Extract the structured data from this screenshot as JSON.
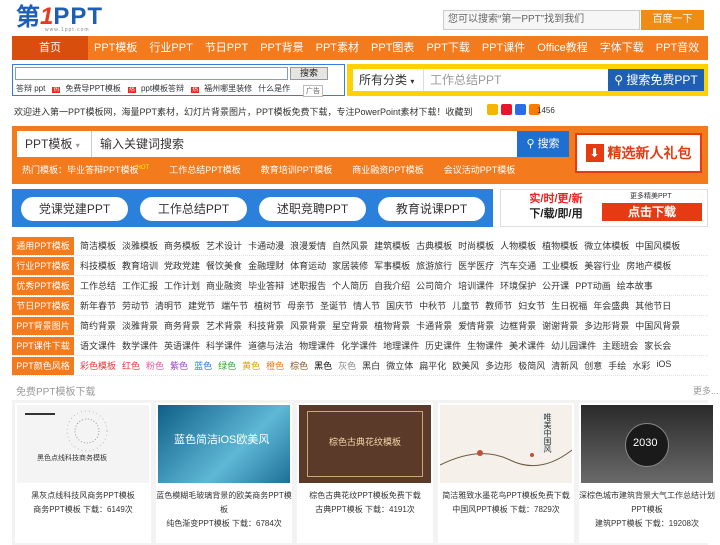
{
  "header": {
    "logo_text_1": "第",
    "logo_text_2": "1",
    "logo_text_3": "PPT",
    "logo_sub": "www.1ppt.com",
    "search_placeholder": "您可以搜索“第一PPT”找到我们",
    "search_button": "百度一下"
  },
  "nav": [
    "首页",
    "PPT模板",
    "行业PPT",
    "节日PPT",
    "PPT背景",
    "PPT素材",
    "PPT图表",
    "PPT下载",
    "PPT课件",
    "Office教程",
    "字体下载",
    "PPT音效"
  ],
  "ad_search": {
    "button": "搜索",
    "links": [
      {
        "text": "答辩 ppt",
        "hot": "热"
      },
      {
        "text": "免费导PPT模板",
        "hot": "热"
      },
      {
        "text": "ppt模板答辩",
        "hot": "热"
      },
      {
        "text": "福州哪里装修",
        "hot": ""
      },
      {
        "text": "什么是作",
        "hot": ""
      }
    ],
    "ad_tag": "广告"
  },
  "category_search": {
    "category": "所有分类",
    "placeholder": "工作总结PPT",
    "button": "搜索免费PPT"
  },
  "welcome": {
    "text": "欢迎进入第一PPT模板网，海量PPT素材，幻灯片背景图片，PPT模板免费下载，专注PowerPoint素材下载！收藏到",
    "share_count": "1456"
  },
  "main_search": {
    "select": "PPT模板",
    "input": "输入关键词搜索",
    "button": "搜索",
    "gift": "精选新人礼包"
  },
  "hot_templates": {
    "label": "热门模板：",
    "items": [
      "毕业答辩PPT模板",
      "工作总结PPT模板",
      "教育培训PPT模板",
      "商业融资PPT模板",
      "会议活动PPT模板"
    ],
    "hot_badge": "HOT"
  },
  "quick_buttons": [
    "党课党建PPT",
    "工作总结PPT",
    "述职竞聘PPT",
    "教育说课PPT"
  ],
  "promo": {
    "line1_a": "实/时/更/新",
    "line2": "下/载/即/用",
    "more": "更多精美PPT",
    "button": "点击下载"
  },
  "categories": [
    {
      "label": "通用PPT模板",
      "items": [
        "简洁模板",
        "淡雅模板",
        "商务模板",
        "艺术设计",
        "卡通动漫",
        "浪漫爱情",
        "自然风景",
        "建筑模板",
        "古典模板",
        "时尚模板",
        "人物模板",
        "植物模板",
        "微立体模板",
        "中国风模板"
      ]
    },
    {
      "label": "行业PPT模板",
      "items": [
        "科技模板",
        "教育培训",
        "党政党建",
        "餐饮美食",
        "金融理财",
        "体育运动",
        "家居装修",
        "军事模板",
        "旅游旅行",
        "医学医疗",
        "汽车交通",
        "工业模板",
        "美容行业",
        "房地产模板"
      ]
    },
    {
      "label": "优秀PPT模板",
      "items": [
        "工作总结",
        "工作汇报",
        "工作计划",
        "商业融资",
        "毕业答辩",
        "述职报告",
        "个人简历",
        "自我介绍",
        "公司简介",
        "培训课件",
        "环境保护",
        "公开课",
        "PPT动画",
        "绘本故事"
      ]
    },
    {
      "label": "节日PPT模板",
      "items": [
        "新年春节",
        "劳动节",
        "清明节",
        "建党节",
        "端午节",
        "植树节",
        "母亲节",
        "圣诞节",
        "情人节",
        "国庆节",
        "中秋节",
        "儿童节",
        "教师节",
        "妇女节",
        "生日祝福",
        "年会盛典",
        "其他节日"
      ]
    },
    {
      "label": "PPT背景图片",
      "items": [
        "简约背景",
        "淡雅背景",
        "商务背景",
        "艺术背景",
        "科技背景",
        "风景背景",
        "星空背景",
        "植物背景",
        "卡通背景",
        "爱情背景",
        "边框背景",
        "谢谢背景",
        "多边形背景",
        "中国风背景"
      ]
    },
    {
      "label": "PPT课件下载",
      "items": [
        "语文课件",
        "数学课件",
        "英语课件",
        "科学课件",
        "道德与法治",
        "物理课件",
        "化学课件",
        "地理课件",
        "历史课件",
        "生物课件",
        "美术课件",
        "幼儿园课件",
        "主题班会",
        "家长会"
      ]
    },
    {
      "label": "PPT颜色风格",
      "items": [
        {
          "text": "彩色模板",
          "color": "#e33",
          "style": "c-red"
        },
        {
          "text": "红色",
          "style": "c-red"
        },
        {
          "text": "粉色",
          "style": "c-pink"
        },
        {
          "text": "紫色",
          "style": "c-purple"
        },
        {
          "text": "蓝色",
          "style": "c-blue"
        },
        {
          "text": "绿色",
          "style": "c-green"
        },
        {
          "text": "黄色",
          "style": "c-yellow"
        },
        {
          "text": "橙色",
          "style": "c-orange"
        },
        {
          "text": "棕色",
          "style": "c-brown"
        },
        {
          "text": "黑色",
          "style": "c-black"
        },
        {
          "text": "灰色",
          "style": "c-gray"
        },
        {
          "text": "黑白",
          "style": ""
        },
        {
          "text": "微立体",
          "style": ""
        },
        {
          "text": "扁平化",
          "style": ""
        },
        {
          "text": "欧美风",
          "style": ""
        },
        {
          "text": "多边形",
          "style": ""
        },
        {
          "text": "极简风",
          "style": ""
        },
        {
          "text": "清新风",
          "style": ""
        },
        {
          "text": "创意",
          "style": ""
        },
        {
          "text": "手绘",
          "style": ""
        },
        {
          "text": "水彩",
          "style": ""
        },
        {
          "text": "iOS",
          "style": ""
        }
      ]
    }
  ],
  "free_section": {
    "title": "免费PPT模板下载",
    "more": "更多...",
    "cards": [
      {
        "thumb_title": "黑色点线科技商务模板",
        "title": "黑灰点线科技风商务PPT模板",
        "sub": "商务PPT模板",
        "downloads": "下载：6149次"
      },
      {
        "thumb_title": "蓝色简洁iOS欧美风",
        "title": "蓝色模糊毛玻璃背景的欧美商务PPT模板",
        "sub": "纯色渐变PPT模板",
        "downloads": "下载：6784次"
      },
      {
        "thumb_title": "棕色古典花纹模板",
        "title": "棕色古典花纹PPT模板免费下载",
        "sub": "古典PPT模板",
        "downloads": "下载：4191次"
      },
      {
        "thumb_title": "唯美中国风",
        "title": "简洁雅致水墨花鸟PPT模板免费下载",
        "sub": "中国风PPT模板",
        "downloads": "下载：7829次"
      },
      {
        "thumb_title": "2030",
        "title": "深棕色城市建筑背景大气工作总结计划PPT模板",
        "sub": "建筑PPT模板",
        "downloads": "下载：19208次"
      }
    ]
  },
  "colors": {
    "orange": "#f47a1e",
    "blue": "#2b80dc",
    "red": "#e53a12",
    "yellow": "#ffd100"
  }
}
